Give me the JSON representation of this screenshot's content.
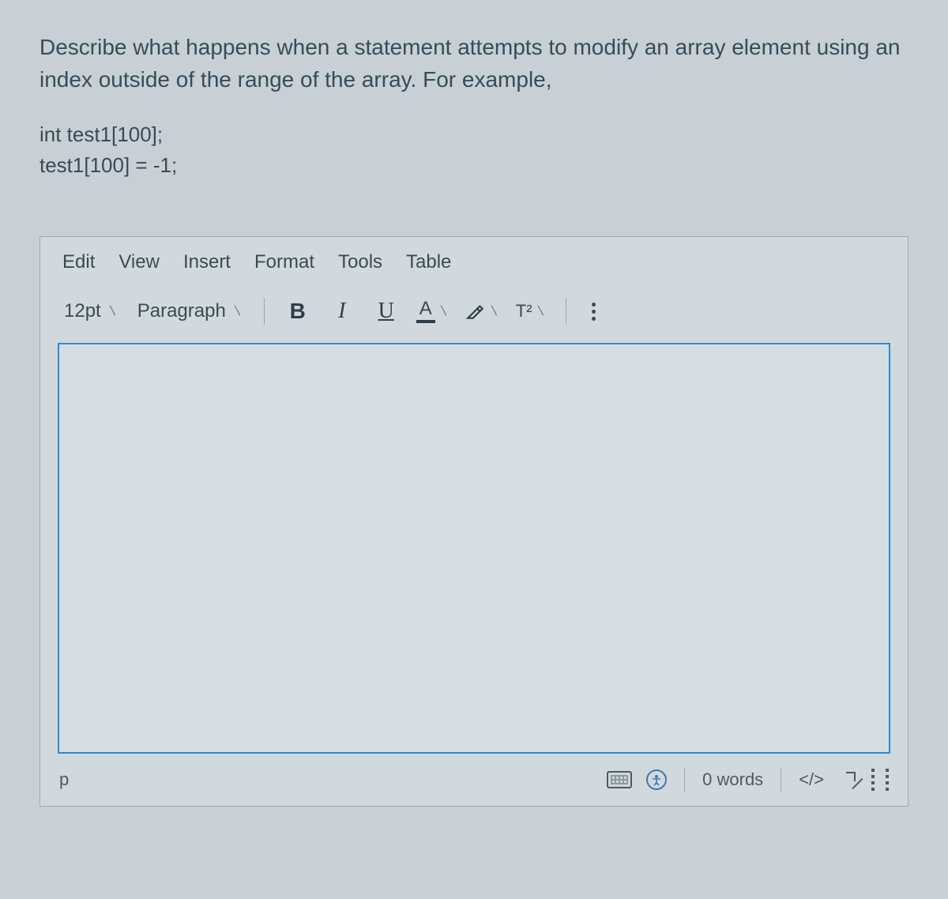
{
  "question": {
    "prompt": "Describe what happens when a statement attempts to modify an array element using an index outside of the range of the array. For example,",
    "code_line1": "int test1[100];",
    "code_line2": "test1[100] = -1;"
  },
  "editor": {
    "menus": [
      "Edit",
      "View",
      "Insert",
      "Format",
      "Tools",
      "Table"
    ],
    "toolbar": {
      "font_size": "12pt",
      "block_format": "Paragraph",
      "bold": "B",
      "italic": "I",
      "underline": "U",
      "text_color": "A",
      "superscript": "T²"
    },
    "content": "",
    "status": {
      "path": "p",
      "word_count": "0 words",
      "code_view": "</>"
    }
  }
}
